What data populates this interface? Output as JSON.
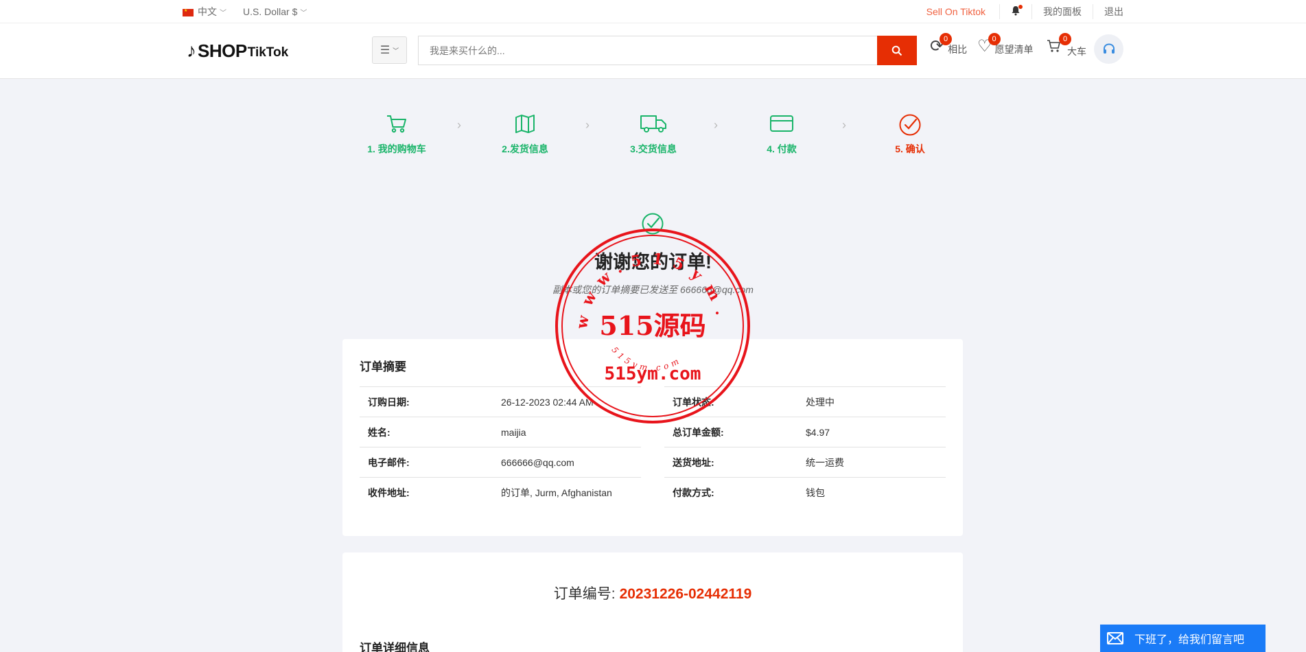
{
  "topbar": {
    "language": "中文",
    "currency": "U.S. Dollar $",
    "sell_link": "Sell On Tiktok",
    "dashboard": "我的面板",
    "logout": "退出"
  },
  "header": {
    "logo_shop": "SHOP",
    "logo_tiktok": "TikTok",
    "search_placeholder": "我是来买什么的...",
    "compare": {
      "label": "相比",
      "count": "0"
    },
    "wishlist": {
      "label": "愿望清单",
      "count": "0"
    },
    "cart": {
      "label": "大车",
      "count": "0"
    }
  },
  "steps": [
    {
      "label": "1. 我的购物车",
      "icon": "cart-icon"
    },
    {
      "label": "2.发货信息",
      "icon": "map-icon"
    },
    {
      "label": "3.交货信息",
      "icon": "truck-icon"
    },
    {
      "label": "4. 付款",
      "icon": "card-icon"
    },
    {
      "label": "5. 确认",
      "icon": "check-circle-icon"
    }
  ],
  "thanks": {
    "title": "谢谢您的订单!",
    "subtitle": "副本或您的订单摘要已发送至 666666@qq.com"
  },
  "summary": {
    "title": "订单摘要",
    "left": [
      {
        "k": "订购日期:",
        "v": "26-12-2023 02:44 AM"
      },
      {
        "k": "姓名:",
        "v": "maijia"
      },
      {
        "k": "电子邮件:",
        "v": "666666@qq.com"
      },
      {
        "k": "收件地址:",
        "v": "的订单, Jurm, Afghanistan"
      }
    ],
    "right": [
      {
        "k": "订单状态:",
        "v": "处理中"
      },
      {
        "k": "总订单金额:",
        "v": "$4.97"
      },
      {
        "k": "送货地址:",
        "v": "统一运费"
      },
      {
        "k": "付款方式:",
        "v": "钱包"
      }
    ]
  },
  "order": {
    "number_label": "订单编号:",
    "number": "20231226-02442119",
    "details_title": "订单详细信息"
  },
  "stamp": {
    "main": "515源码",
    "domain": "515ym.com",
    "ring": "www.515ym.com"
  },
  "chat": {
    "label": "下班了，给我们留言吧"
  },
  "colors": {
    "accent": "#e62e04",
    "green": "#19b469",
    "chat": "#1a7bf7"
  }
}
